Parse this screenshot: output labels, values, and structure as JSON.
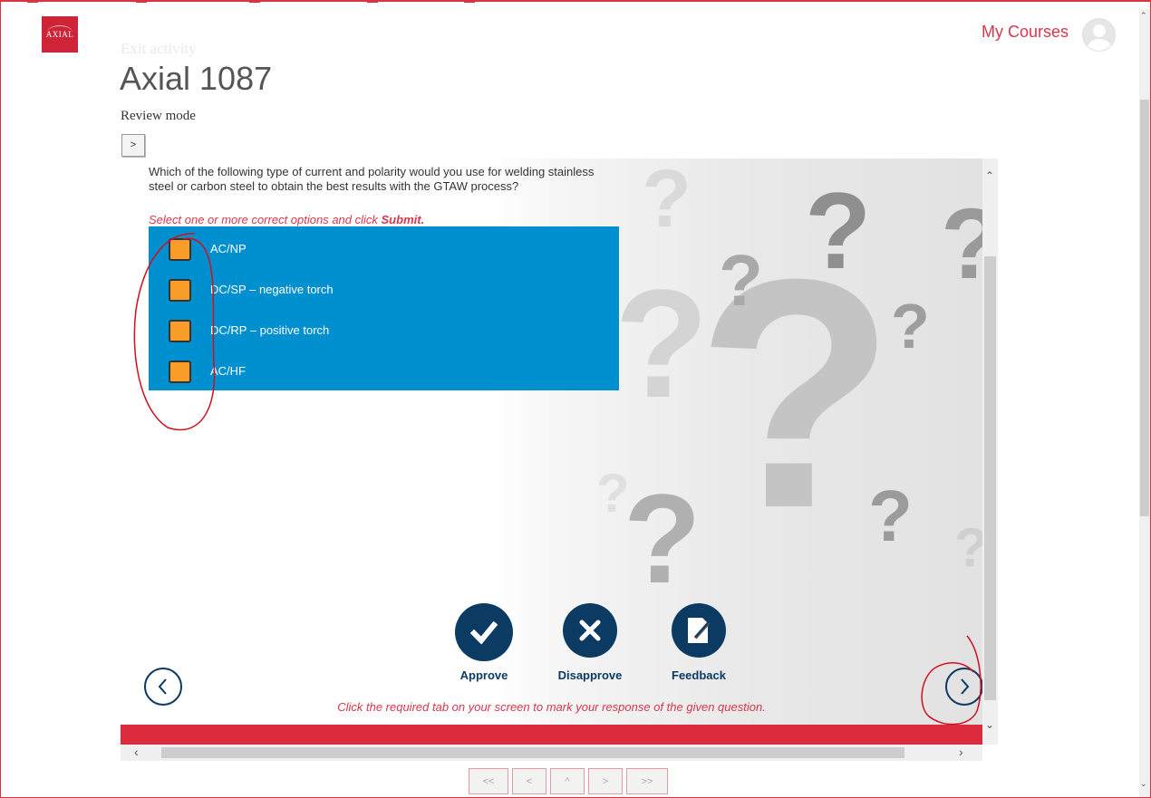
{
  "header": {
    "logo_text": "AXIAL",
    "my_courses_label": "My Courses"
  },
  "page": {
    "exit_activity": "Exit activity",
    "title": "Axial 1087",
    "mode": "Review mode",
    "toggle_label": ">"
  },
  "quiz": {
    "question": "Which of the following type of current and polarity would you use for welding stainless steel or carbon steel to obtain the best results with the GTAW process?",
    "instruction_prefix": "Select one or more correct options and click ",
    "instruction_action": "Submit.",
    "options": [
      {
        "label": "AC/NP",
        "checked": false
      },
      {
        "label": "DC/SP – negative torch",
        "checked": false
      },
      {
        "label": "DC/RP – positive torch",
        "checked": false
      },
      {
        "label": "AC/HF",
        "checked": false
      }
    ],
    "actions": {
      "approve": "Approve",
      "disapprove": "Disapprove",
      "feedback": "Feedback"
    },
    "footer_note": "Click the required tab on your screen to mark your response of the given question."
  },
  "pager": {
    "first": "<<",
    "prev": "<",
    "up": "^",
    "next": ">",
    "last": ">>"
  },
  "colors": {
    "accent_red": "#dc2a3e",
    "options_blue": "#0090d0",
    "checkbox_orange": "#f99d28",
    "navy": "#0b3a63"
  },
  "icons": [
    "check-icon",
    "cross-icon",
    "edit-note-icon",
    "chevron-left-icon",
    "chevron-right-icon",
    "user-avatar-icon"
  ]
}
